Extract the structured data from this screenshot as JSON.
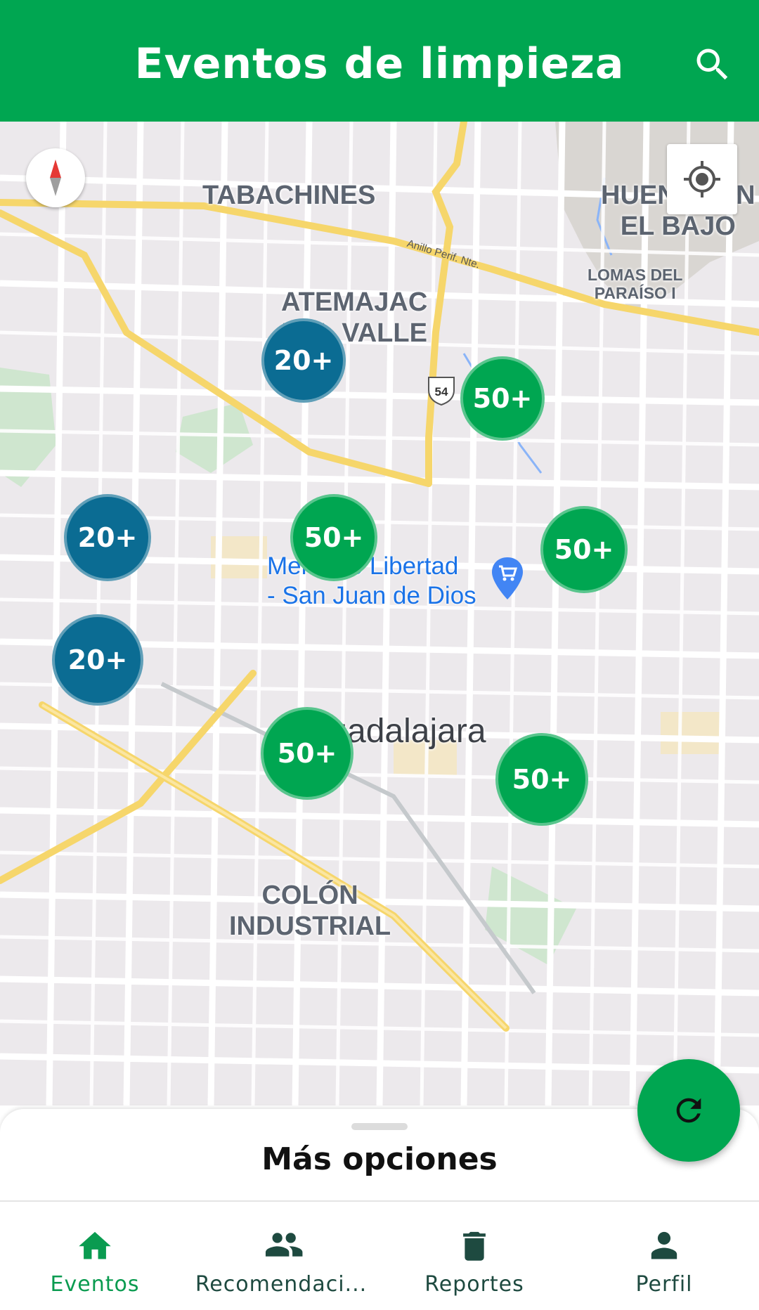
{
  "header": {
    "title": "Eventos de limpieza",
    "search_icon": "search-icon"
  },
  "colors": {
    "primary": "#00a651",
    "cluster_green": "#00a651",
    "cluster_blue": "#0b6c93",
    "nav_active": "#0a9b50",
    "nav_inactive": "#1e4a40"
  },
  "map": {
    "labels": {
      "tabachines": "TABACHINES",
      "huentitan": "HUENTITÁN\nEL BAJO",
      "lomas": "LOMAS DEL\nPARAÍSO I",
      "atemajac": "ATEMAJAC\nDEL VALLE",
      "guadalajara": "Guadalajara",
      "colon": "COLÓN\nINDUSTRIAL",
      "road": "Anillo Perif. Nte.",
      "route_shield": "54"
    },
    "poi": {
      "name": "Mercado Libertad\n- San Juan de Dios",
      "icon": "shopping-cart-icon"
    },
    "clusters": [
      {
        "label": "20+",
        "kind": "blue"
      },
      {
        "label": "50+",
        "kind": "green"
      },
      {
        "label": "20+",
        "kind": "blue"
      },
      {
        "label": "50+",
        "kind": "green"
      },
      {
        "label": "50+",
        "kind": "green"
      },
      {
        "label": "20+",
        "kind": "blue"
      },
      {
        "label": "50+",
        "kind": "green"
      },
      {
        "label": "50+",
        "kind": "green"
      }
    ]
  },
  "sheet": {
    "title": "Más opciones"
  },
  "fab": {
    "icon": "refresh-icon"
  },
  "nav": {
    "items": [
      {
        "label": "Eventos",
        "icon": "home-icon",
        "active": true
      },
      {
        "label": "Recomendaci...",
        "icon": "group-icon",
        "active": false
      },
      {
        "label": "Reportes",
        "icon": "trash-icon",
        "active": false
      },
      {
        "label": "Perfil",
        "icon": "person-icon",
        "active": false
      }
    ]
  }
}
